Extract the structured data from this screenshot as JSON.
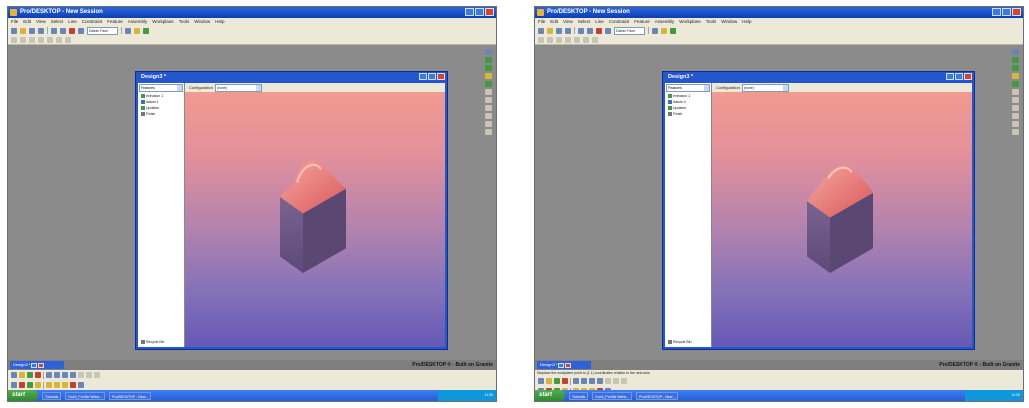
{
  "app": {
    "title": "Pro/DESKTOP - New Session",
    "menu": [
      "File",
      "Edit",
      "View",
      "Select",
      "Line",
      "Constraint",
      "Feature",
      "Assembly",
      "Workplane",
      "Tools",
      "Window",
      "Help"
    ],
    "toolbar": {
      "datum_field": "Datum Face"
    },
    "branding": "Pro/DESKTOP ® - Built on Granite"
  },
  "design": {
    "title": "Design3 *",
    "panel_select": "Features",
    "tree_items": [
      "extrusion 1",
      "datum 1",
      "Updates",
      "Finish"
    ],
    "tree_items_right": [
      "extrusion 1",
      "datum 4",
      "Updates",
      "Finish"
    ],
    "recycle_bin": "Recycle Bin",
    "configuration_label": "Configuration",
    "configuration_value": "(none)",
    "tab_label": "Design3 *"
  },
  "status_right": "Displace the workplane point to (1,1) coordinates relative to the next axis",
  "taskbar": {
    "start": "start",
    "tasks": [
      "Tutorials",
      "Doc3_Pro/Ne Webs...",
      "Pro/DESKTOP - New..."
    ],
    "clock": "11:25"
  },
  "colors": {
    "viewport_top": "#f19a92",
    "viewport_bottom": "#6659b6",
    "solid_front": "#6e5a86",
    "solid_side": "#5a4872",
    "cap_top": "#e9776f"
  }
}
